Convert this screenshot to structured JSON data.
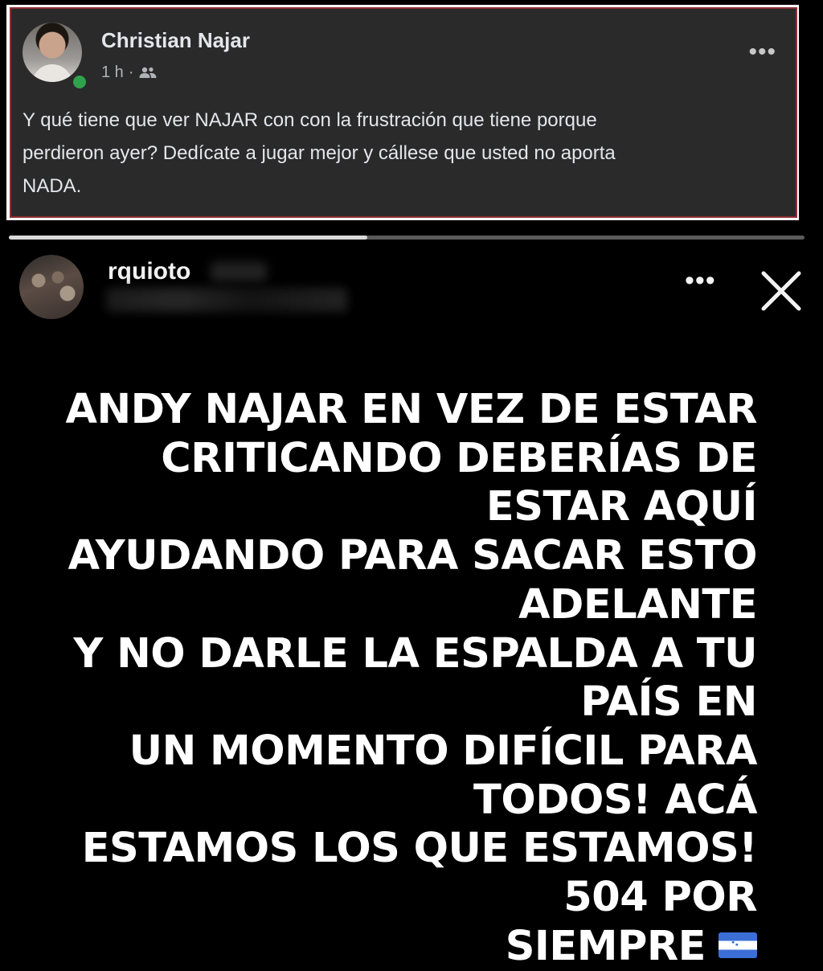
{
  "facebook_comment": {
    "author": "Christian Najar",
    "time": "1 h",
    "separator": "·",
    "audience_icon": "friends-icon",
    "more_icon": "more-horizontal-icon",
    "lines": [
      "Y qué tiene que ver NAJAR con con la frustración que tiene porque",
      "perdieron ayer? Dedícate a jugar mejor y cállese que usted no aporta",
      "NADA."
    ],
    "online_status_color": "#31a24c",
    "border_color": "#8e2f33"
  },
  "instagram_story": {
    "username": "rquioto",
    "progress": 0.45,
    "more_icon": "more-horizontal-icon",
    "close_icon": "close-icon",
    "lines": [
      "ANDY NAJAR EN VEZ DE ESTAR",
      "CRITICANDO DEBERÍAS DE ESTAR AQUÍ",
      "AYUDANDO PARA SACAR ESTO ADELANTE",
      "Y NO DARLE LA ESPALDA A TU PAÍS EN",
      "UN MOMENTO DIFÍCIL PARA TODOS! ACÁ",
      "ESTAMOS LOS QUE ESTAMOS! 504 POR",
      "SIEMPRE"
    ],
    "flag_icon": "honduras-flag-icon"
  }
}
